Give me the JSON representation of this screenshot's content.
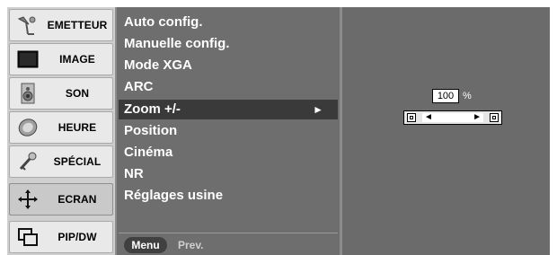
{
  "categories": [
    {
      "label": "EMETTEUR",
      "icon": "antenna-icon",
      "selected": false
    },
    {
      "label": "IMAGE",
      "icon": "screen-icon",
      "selected": false
    },
    {
      "label": "SON",
      "icon": "speaker-icon",
      "selected": false
    },
    {
      "label": "HEURE",
      "icon": "clock-icon",
      "selected": false
    },
    {
      "label": "SPÉCIAL",
      "icon": "key-icon",
      "selected": false
    },
    {
      "label": "ECRAN",
      "icon": "move-arrows-icon",
      "selected": true
    },
    {
      "label": "PIP/DW",
      "icon": "pip-icon",
      "selected": false
    }
  ],
  "menu": {
    "items": [
      {
        "label": "Auto config."
      },
      {
        "label": "Manuelle config."
      },
      {
        "label": "Mode XGA"
      },
      {
        "label": "ARC"
      },
      {
        "label": "Zoom +/-",
        "selected": true,
        "submenu_arrow": "►"
      },
      {
        "label": "Position"
      },
      {
        "label": "Cinéma"
      },
      {
        "label": "NR"
      },
      {
        "label": "Réglages usine"
      }
    ],
    "menu_button": "Menu",
    "prev_label": "Prev."
  },
  "zoom": {
    "value": "100",
    "unit": "%",
    "left_arrow": "◄",
    "right_arrow": "►"
  }
}
